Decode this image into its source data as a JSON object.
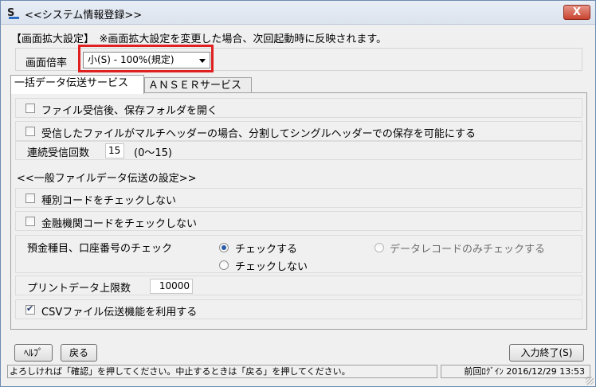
{
  "window": {
    "title": "<<システム情報登録>>",
    "close_label": "X"
  },
  "screen_zoom": {
    "note": "【画面拡大設定】　※画面拡大設定を変更した場合、次回起動時に反映されます。",
    "label": "画面倍率",
    "selected": "小(S) - 100%(規定)"
  },
  "tabs": [
    {
      "label": "一括データ伝送サービス",
      "active": true
    },
    {
      "label": "ＡＮＳＥＲサービス",
      "active": false
    }
  ],
  "bulk": {
    "open_folder_label": "ファイル受信後、保存フォルダを開く",
    "open_folder_checked": false,
    "multi_header_label": "受信したファイルがマルチヘッダーの場合、分割してシングルヘッダーでの保存を可能にする",
    "multi_header_checked": false,
    "continuous_label": "連続受信回数",
    "continuous_value": "15",
    "continuous_range": "(0～15)",
    "section_title": "<<一般ファイルデータ伝送の設定>>",
    "type_code_label": "種別コードをチェックしない",
    "type_code_checked": false,
    "bank_code_label": "金融機関コードをチェックしない",
    "bank_code_checked": false,
    "account_check_label": "預金種目、口座番号のチェック",
    "radio_check": "チェックする",
    "radio_nocheck": "チェックしない",
    "radio_record_only": "データレコードのみチェックする",
    "print_limit_label": "プリントデータ上限数",
    "print_limit_value": "10000",
    "csv_label": "CSVファイル伝送機能を利用する",
    "csv_checked": true
  },
  "buttons": {
    "help": "ﾍﾙﾌﾟ",
    "back": "戻る",
    "finish": "入力終了(S)"
  },
  "status": {
    "message": "よろしければ「確認」を押してください。中止するときは「戻る」を押してください。",
    "last_login": "前回ﾛｸﾞｲﾝ 2016/12/29 13:53"
  }
}
